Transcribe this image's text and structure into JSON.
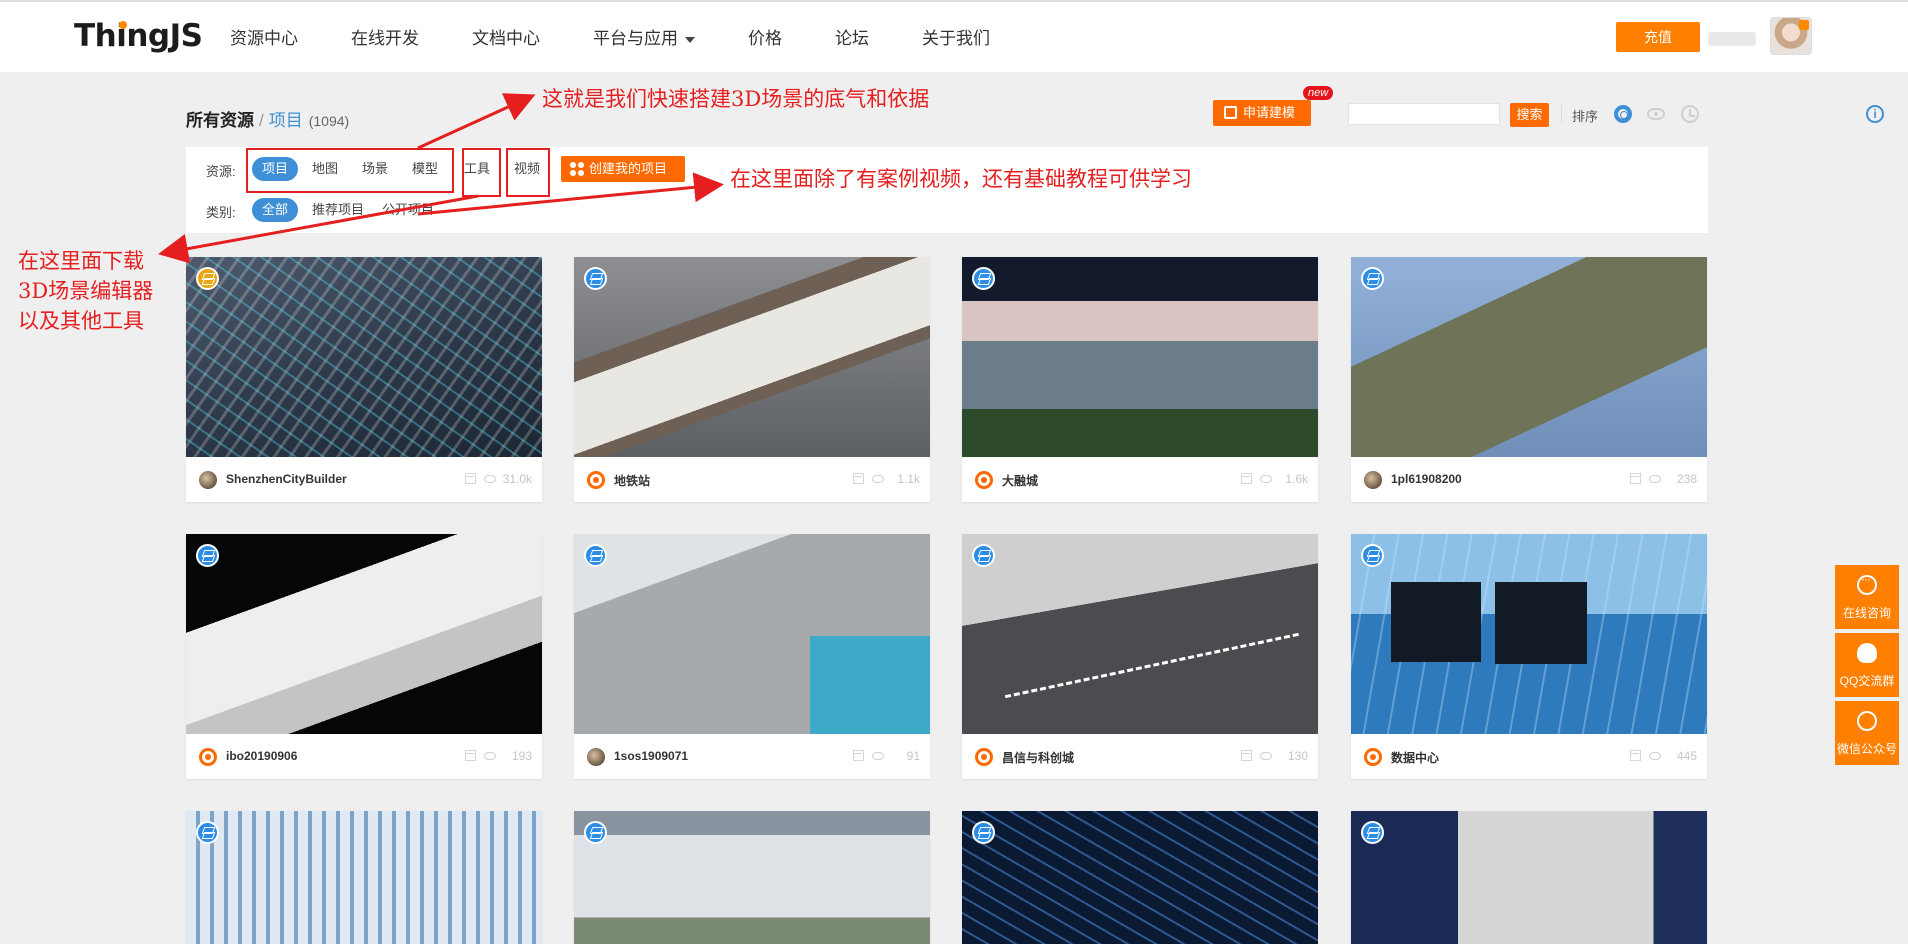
{
  "header": {
    "logo": "ThingJS",
    "nav": [
      "资源中心",
      "在线开发",
      "文档中心",
      "平台与应用",
      "价格",
      "论坛",
      "关于我们"
    ],
    "recharge_label": "充值"
  },
  "breadcrumb": {
    "root": "所有资源",
    "separator": "/",
    "current": "项目",
    "count": "(1094)"
  },
  "toolbar": {
    "apply_label": "申请建模",
    "new_badge": "new",
    "search_placeholder": "",
    "search_label": "搜索",
    "sort_label": "排序"
  },
  "filters": {
    "resource_label": "资源:",
    "resources": [
      "项目",
      "地图",
      "场景",
      "模型",
      "工具",
      "视频"
    ],
    "create_label": "创建我的项目",
    "category_label": "类别:",
    "categories": [
      "全部",
      "推荐项目",
      "公开项目"
    ]
  },
  "cards": [
    {
      "author": "ShenzhenCityBuilder",
      "views": "31.0k"
    },
    {
      "author": "地铁站",
      "views": "1.1k"
    },
    {
      "author": "大融城",
      "views": "1.6k"
    },
    {
      "author": "1pl61908200",
      "views": "238"
    },
    {
      "author": "ibo20190906",
      "views": "193"
    },
    {
      "author": "1sos1909071",
      "views": "91"
    },
    {
      "author": "昌信与科创城",
      "views": "130"
    },
    {
      "author": "数据中心",
      "views": "445"
    }
  ],
  "side_panel": [
    "在线咨询",
    "QQ交流群",
    "微信公众号"
  ],
  "annotations": {
    "top": "这就是我们快速搭建3D场景的底气和依据",
    "right": "在这里面除了有案例视频，还有基础教程可供学习",
    "left": [
      "在这里面下载",
      "3D场景编辑器",
      "以及其他工具"
    ]
  },
  "colors": {
    "accent": "#ff6a00",
    "primary_blue": "#3f8fd6",
    "annotation_red": "#e51f1f"
  }
}
